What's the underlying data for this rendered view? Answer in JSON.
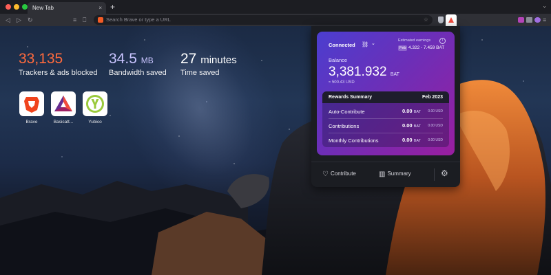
{
  "browser": {
    "tab_title": "New Tab",
    "tab_close": "×",
    "new_tab": "+",
    "url_placeholder": "Search Brave or type a URL"
  },
  "stats": [
    {
      "value": "33,135",
      "unit": "",
      "label": "Trackers & ads blocked",
      "color": "#ff6a3d"
    },
    {
      "value": "34.5",
      "unit": "MB",
      "label": "Bandwidth saved",
      "color": "#c9c4ff"
    },
    {
      "value": "27",
      "unit": "minutes",
      "label": "Time saved",
      "color": "#ffffff"
    }
  ],
  "top_sites": [
    {
      "label": "Brave",
      "icon": "brave-lion-icon",
      "color": "#f0441d"
    },
    {
      "label": "Basicatt...",
      "icon": "bat-triangle-icon",
      "color": "#662d91"
    },
    {
      "label": "Yubico",
      "icon": "yubico-icon",
      "color": "#9aca3c"
    }
  ],
  "rewards": {
    "connected_label": "Connected",
    "estimated_label": "Estimated earnings",
    "est_month": "Feb",
    "est_range": "4.322 - 7.459 BAT",
    "balance_label": "Balance",
    "balance_value": "3,381.932",
    "balance_unit": "BAT",
    "balance_usd": "≈ 500.43 USD",
    "summary_title": "Rewards Summary",
    "summary_month": "Feb 2023",
    "rows": [
      {
        "label": "Auto-Contribute",
        "bat": "0.00",
        "bat_unit": "BAT",
        "usd": "0.00 USD"
      },
      {
        "label": "Contributions",
        "bat": "0.00",
        "bat_unit": "BAT",
        "usd": "0.00 USD"
      },
      {
        "label": "Monthly Contributions",
        "bat": "0.00",
        "bat_unit": "BAT",
        "usd": "0.00 USD"
      }
    ],
    "contribute_label": "Contribute",
    "summary_button_label": "Summary",
    "gradient_start": "#4b3ecf",
    "gradient_end": "#9a1e9f"
  }
}
